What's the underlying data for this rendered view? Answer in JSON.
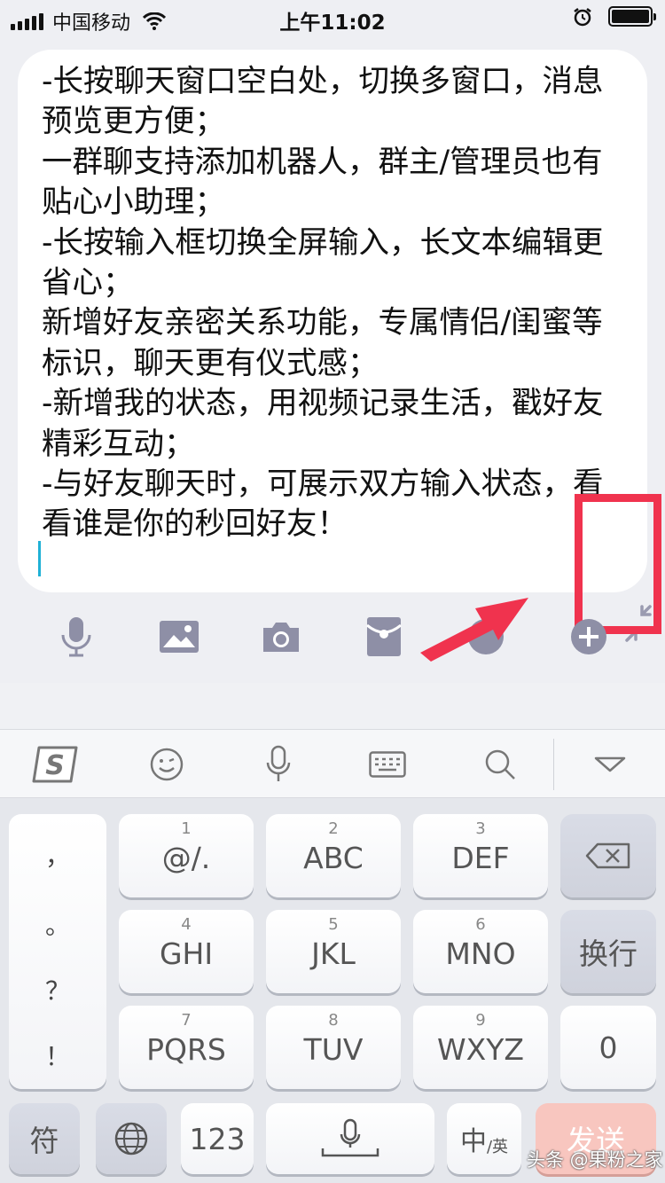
{
  "status_bar": {
    "carrier": "中国移动",
    "time": "上午11:02"
  },
  "editor": {
    "text": "-长按聊天窗口空白处，切换多窗口，消息预览更方便；\n一群聊支持添加机器人，群主/管理员也有贴心小助理；\n-长按输入框切换全屏输入，长文本编辑更省心；\n新增好友亲密关系功能，专属情侣/闺蜜等标识，聊天更有仪式感；\n-新增我的状态，用视频记录生活，戳好友精彩互动；\n-与好友聊天时，可展示双方输入状态，看看谁是你的秒回好友！"
  },
  "toolbar": {
    "icons": [
      "mic-icon",
      "image-icon",
      "camera-icon",
      "red-packet-icon",
      "emoji-icon",
      "plus-icon"
    ]
  },
  "keyboard_top": {
    "icons": [
      "sogou-logo-icon",
      "emoji-face-icon",
      "voice-icon",
      "keyboard-icon",
      "search-icon",
      "collapse-keyboard-icon"
    ]
  },
  "keyboard": {
    "punct": [
      "，",
      "。",
      "？",
      "！"
    ],
    "keys": [
      {
        "num": "1",
        "label": "@/."
      },
      {
        "num": "2",
        "label": "ABC"
      },
      {
        "num": "3",
        "label": "DEF"
      },
      {
        "num": "4",
        "label": "GHI"
      },
      {
        "num": "5",
        "label": "JKL"
      },
      {
        "num": "6",
        "label": "MNO"
      },
      {
        "num": "7",
        "label": "PQRS"
      },
      {
        "num": "8",
        "label": "TUV"
      },
      {
        "num": "9",
        "label": "WXYZ"
      }
    ],
    "newline": "换行",
    "zero": "0",
    "symbol": "符",
    "numbers": "123",
    "lang_main": "中",
    "lang_sub": "/英",
    "send": "发送"
  },
  "watermark": "头条 @果粉之家",
  "colors": {
    "highlight": "#f0334e",
    "caret": "#1fb1d6",
    "toolbar_icon": "#8e8fa6"
  }
}
